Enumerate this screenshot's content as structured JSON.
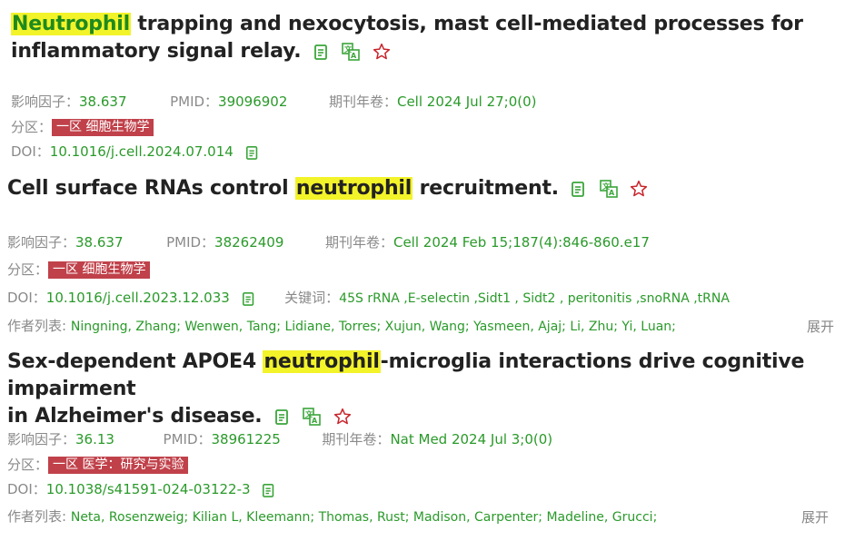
{
  "articles": [
    {
      "title_highlight": "Neutrophil",
      "title_rest": " trapping and nexocytosis, mast cell-mediated processes for",
      "title_line2": "inflammatory signal relay.",
      "impact_label": "影响因子：",
      "impact_value": "38.637",
      "pmid_label": "PMID：",
      "pmid_value": "39096902",
      "journal_label": "期刊年卷：",
      "journal_value": "Cell 2024 Jul 27;0(0)",
      "zone_label": "分区：",
      "zone_badge": "一区 细胞生物学",
      "doi_label": "DOI：",
      "doi_value": "10.1016/j.cell.2024.07.014"
    },
    {
      "title_pre": "Cell surface RNAs control ",
      "title_highlight": "neutrophil",
      "title_post": " recruitment.",
      "impact_label": "影响因子：",
      "impact_value": "38.637",
      "pmid_label": "PMID：",
      "pmid_value": "38262409",
      "journal_label": "期刊年卷：",
      "journal_value": "Cell 2024 Feb 15;187(4):846-860.e17",
      "zone_label": "分区：",
      "zone_badge": "一区 细胞生物学",
      "doi_label": "DOI：",
      "doi_value": "10.1016/j.cell.2023.12.033",
      "keywords_label": "关键词：",
      "keywords_value": "45S rRNA ,E-selectin ,Sidt1 , Sidt2 , peritonitis ,snoRNA ,tRNA",
      "authors_label": "作者列表:",
      "authors_value": "Ningning, Zhang;  Wenwen, Tang;  Lidiane, Torres;  Xujun, Wang;  Yasmeen, Ajaj;  Li, Zhu;  Yi, Luan;",
      "expand_label": "展开"
    },
    {
      "title_pre": "Sex-dependent APOE4 ",
      "title_highlight": "neutrophil",
      "title_post": "-microglia interactions drive cognitive impairment",
      "title_line2": "in Alzheimer's disease.",
      "impact_label": "影响因子：",
      "impact_value": "36.13",
      "pmid_label": "PMID：",
      "pmid_value": "38961225",
      "journal_label": "期刊年卷：",
      "journal_value": "Nat Med 2024 Jul 3;0(0)",
      "zone_label": "分区：",
      "zone_badge": "一区 医学：研究与实验",
      "doi_label": "DOI：",
      "doi_value": "10.1038/s41591-024-03122-3",
      "authors_label": "作者列表:",
      "authors_value": "Neta, Rosenzweig;  Kilian L, Kleemann;  Thomas, Rust;  Madison, Carpenter;  Madeline, Grucci;",
      "expand_label": "展开"
    }
  ],
  "icons": {
    "copy": "copy-icon",
    "translate": "translate-icon",
    "favorite": "star-icon"
  },
  "colors": {
    "highlight": "#f3f32a",
    "value_green": "#2a9a2a",
    "badge_red": "#c0414a",
    "star_red": "#c8242b"
  }
}
